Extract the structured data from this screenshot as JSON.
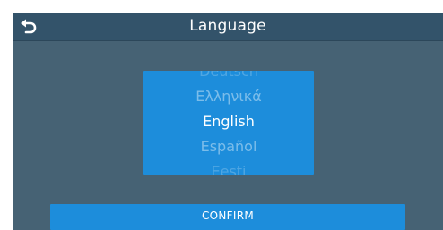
{
  "header": {
    "title": "Language",
    "back_icon": "back-arrow-icon"
  },
  "picker": {
    "items": [
      {
        "label": "Deutsch"
      },
      {
        "label": "Ελληνικά"
      },
      {
        "label": "English"
      },
      {
        "label": "Español"
      },
      {
        "label": "Eesti"
      }
    ],
    "selected": "English"
  },
  "footer": {
    "confirm_label": "CONFIRM"
  },
  "colors": {
    "background": "#466274",
    "header": "#33536a",
    "accent": "#1d8ddb",
    "text": "#ffffff"
  }
}
